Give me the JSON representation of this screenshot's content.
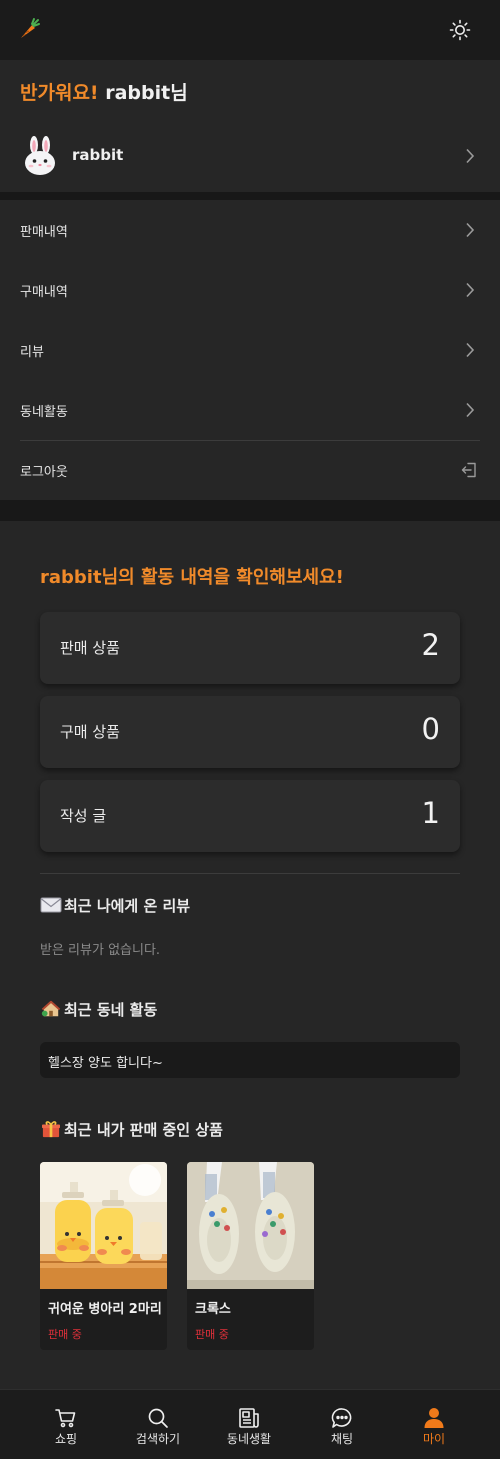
{
  "header": {
    "logo_icon": "carrot-icon",
    "theme_icon": "sun-icon"
  },
  "greeting": {
    "hello": "반가워요!",
    "user": "rabbit님"
  },
  "profile": {
    "name": "rabbit",
    "avatar_icon": "rabbit-icon"
  },
  "menu": {
    "items": [
      {
        "label": "판매내역"
      },
      {
        "label": "구매내역"
      },
      {
        "label": "리뷰"
      },
      {
        "label": "동네활동"
      },
      {
        "label": "로그아웃"
      }
    ]
  },
  "activity": {
    "title": "rabbit님의 활동 내역을 확인해보세요!",
    "stats": [
      {
        "label": "판매 상품",
        "value": "2"
      },
      {
        "label": "구매 상품",
        "value": "0"
      },
      {
        "label": "작성 글",
        "value": "1"
      }
    ]
  },
  "reviews": {
    "heading": "최근 나에게 온 리뷰",
    "icon": "envelope-icon",
    "empty": "받은 리뷰가 없습니다."
  },
  "neighborhood": {
    "heading": "최근 동네 활동",
    "icon": "house-icon",
    "post": "헬스장 양도 합니다~"
  },
  "selling": {
    "heading": "최근 내가 판매 중인 상품",
    "icon": "gift-icon",
    "products": [
      {
        "name": "귀여운 병아리 2마리",
        "status": "판매 중"
      },
      {
        "name": "크록스",
        "status": "판매 중"
      }
    ]
  },
  "tabbar": {
    "tabs": [
      {
        "label": "쇼핑",
        "icon": "cart-icon"
      },
      {
        "label": "검색하기",
        "icon": "search-icon"
      },
      {
        "label": "동네생활",
        "icon": "newspaper-icon"
      },
      {
        "label": "채팅",
        "icon": "chat-icon"
      },
      {
        "label": "마이",
        "icon": "user-icon"
      }
    ],
    "active_color": "#f07a1a"
  },
  "colors": {
    "accent": "#f08a2a",
    "sale_status": "#e0303a",
    "background": "#262626"
  }
}
